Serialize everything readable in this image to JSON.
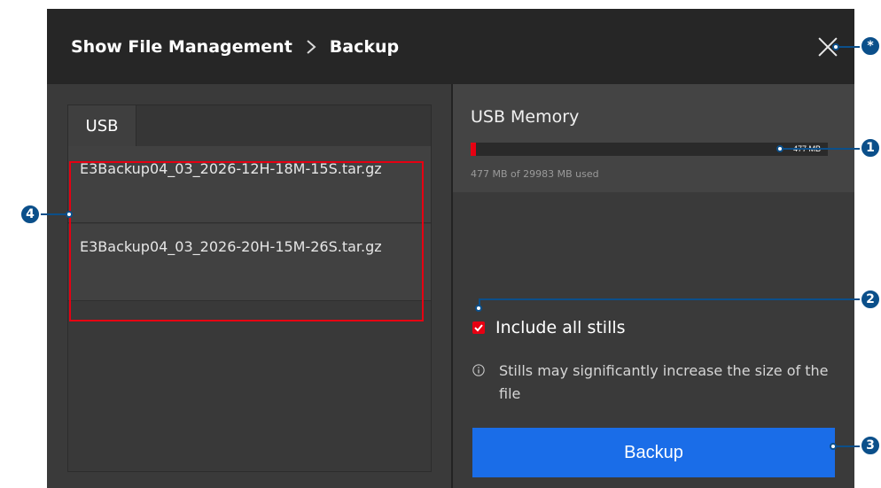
{
  "header": {
    "breadcrumb_root": "Show File Management",
    "breadcrumb_separator": "chevron-right-icon",
    "breadcrumb_current": "Backup"
  },
  "left_panel": {
    "tab_label": "USB",
    "files": [
      {
        "name": "E3Backup04_03_2026-12H-18M-15S.tar.gz"
      },
      {
        "name": "E3Backup04_03_2026-20H-15M-26S.tar.gz"
      }
    ]
  },
  "right_panel": {
    "title": "USB Memory",
    "used_mb": 477,
    "total_mb": 29983,
    "used_label": "477 MB",
    "usage_text": "477 MB of 29983 MB used",
    "include_stills_label": "Include all stills",
    "include_stills_checked": true,
    "info_text": "Stills may significantly increase the size of the file",
    "backup_button": "Backup"
  },
  "callouts": {
    "star": "*",
    "c1": "1",
    "c2": "2",
    "c3": "3",
    "c4": "4"
  },
  "colors": {
    "accent_red": "#e60012",
    "button_blue": "#1a6de8",
    "callout_navy": "#0b4f8a"
  }
}
